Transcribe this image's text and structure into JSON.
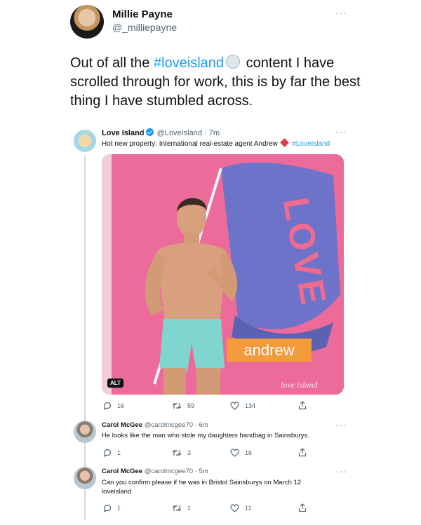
{
  "main_tweet": {
    "name": "Millie Payne",
    "handle": "@_milliepayne",
    "text_before": "Out of all the ",
    "hashtag": "#loveisland",
    "text_after": " content I have scrolled through for work, this is by far the best thing I have stumbled across."
  },
  "quoted_tweet": {
    "name": "Love Island",
    "handle_time": "@LoveIsland · 7m",
    "text": "Hot new property: International real-estate agent Andrew",
    "hashtag": "#LoveIsland",
    "image": {
      "flag_text": "LOVE",
      "name_tag": "andrew",
      "watermark": "love island",
      "alt_badge": "ALT"
    },
    "stats": {
      "replies": "16",
      "retweets": "59",
      "likes": "134"
    }
  },
  "replies": [
    {
      "name": "Carol McGee",
      "handle_time": "@carolmcgee70 · 6m",
      "text": "He looks like the man who stole my daughters handbag in Sainsburys.",
      "stats": {
        "replies": "1",
        "retweets": "3",
        "likes": "16"
      }
    },
    {
      "name": "Carol McGee",
      "handle_time": "@carolmcgee70 · 5m",
      "text": "Can you confirm please if he was in Bristol Sainsburys  on March 12 loveisland",
      "stats": {
        "replies": "1",
        "retweets": "1",
        "likes": "11"
      }
    }
  ],
  "icons": [
    "more-icon",
    "verified-badge-icon",
    "reply-icon",
    "retweet-icon",
    "like-icon",
    "share-icon",
    "heart-flag-emoji-icon"
  ],
  "colors": {
    "link": "#1d9bf0",
    "muted": "#536471",
    "image_bg": "#ee6f9c",
    "flag": "#6d73c9",
    "tag_bg": "#f39a3a"
  }
}
